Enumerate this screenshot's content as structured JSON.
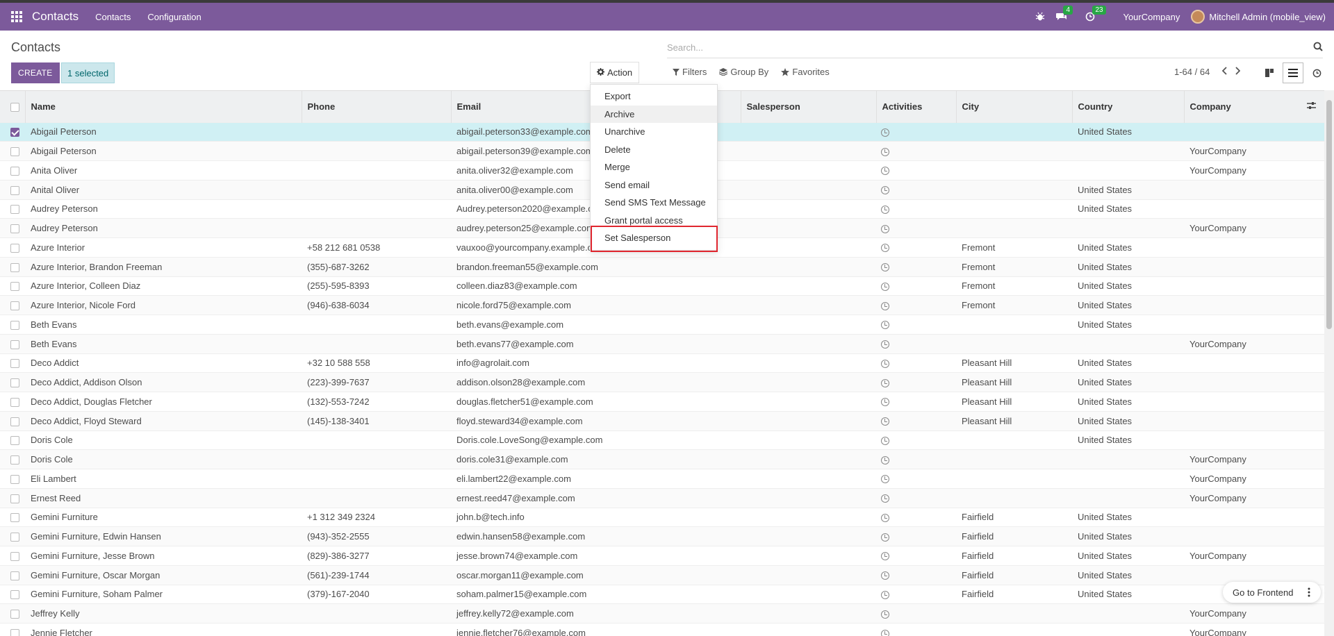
{
  "topbar": {
    "app_title": "Contacts",
    "menu": [
      "Contacts",
      "Configuration"
    ],
    "bug_icon": "bug-icon",
    "messages_count": "4",
    "activities_count": "23",
    "company": "YourCompany",
    "user": "Mitchell Admin (mobile_view)"
  },
  "control": {
    "breadcrumb": "Contacts",
    "search_placeholder": "Search...",
    "create_label": "CREATE",
    "selected_label": "1 selected",
    "action_label": "Action",
    "filters_label": "Filters",
    "groupby_label": "Group By",
    "favorites_label": "Favorites",
    "pager": "1-64 / 64"
  },
  "action_menu": {
    "items": [
      "Export",
      "Archive",
      "Unarchive",
      "Delete",
      "Merge",
      "Send email",
      "Send SMS Text Message",
      "Grant portal access",
      "Set Salesperson"
    ],
    "hover_item": "Archive",
    "highlighted_item": "Set Salesperson"
  },
  "table": {
    "columns": [
      "Name",
      "Phone",
      "Email",
      "Salesperson",
      "Activities",
      "City",
      "Country",
      "Company"
    ],
    "rows": [
      {
        "name": "Abigail Peterson",
        "phone": "",
        "email": "abigail.peterson33@example.com",
        "city": "",
        "country": "United States",
        "company": "",
        "selected": true
      },
      {
        "name": "Abigail Peterson",
        "phone": "",
        "email": "abigail.peterson39@example.com",
        "city": "",
        "country": "",
        "company": "YourCompany"
      },
      {
        "name": "Anita Oliver",
        "phone": "",
        "email": "anita.oliver32@example.com",
        "city": "",
        "country": "",
        "company": "YourCompany"
      },
      {
        "name": "Anital Oliver",
        "phone": "",
        "email": "anita.oliver00@example.com",
        "city": "",
        "country": "United States",
        "company": ""
      },
      {
        "name": "Audrey Peterson",
        "phone": "",
        "email": "Audrey.peterson2020@example.com",
        "city": "",
        "country": "United States",
        "company": ""
      },
      {
        "name": "Audrey Peterson",
        "phone": "",
        "email": "audrey.peterson25@example.com",
        "city": "",
        "country": "",
        "company": "YourCompany"
      },
      {
        "name": "Azure Interior",
        "phone": "+58 212 681 0538",
        "email": "vauxoo@yourcompany.example.com",
        "city": "Fremont",
        "country": "United States",
        "company": ""
      },
      {
        "name": "Azure Interior, Brandon Freeman",
        "phone": "(355)-687-3262",
        "email": "brandon.freeman55@example.com",
        "city": "Fremont",
        "country": "United States",
        "company": ""
      },
      {
        "name": "Azure Interior, Colleen Diaz",
        "phone": "(255)-595-8393",
        "email": "colleen.diaz83@example.com",
        "city": "Fremont",
        "country": "United States",
        "company": ""
      },
      {
        "name": "Azure Interior, Nicole Ford",
        "phone": "(946)-638-6034",
        "email": "nicole.ford75@example.com",
        "city": "Fremont",
        "country": "United States",
        "company": ""
      },
      {
        "name": "Beth Evans",
        "phone": "",
        "email": "beth.evans@example.com",
        "city": "",
        "country": "United States",
        "company": ""
      },
      {
        "name": "Beth Evans",
        "phone": "",
        "email": "beth.evans77@example.com",
        "city": "",
        "country": "",
        "company": "YourCompany"
      },
      {
        "name": "Deco Addict",
        "phone": "+32 10 588 558",
        "email": "info@agrolait.com",
        "city": "Pleasant Hill",
        "country": "United States",
        "company": ""
      },
      {
        "name": "Deco Addict, Addison Olson",
        "phone": "(223)-399-7637",
        "email": "addison.olson28@example.com",
        "city": "Pleasant Hill",
        "country": "United States",
        "company": ""
      },
      {
        "name": "Deco Addict, Douglas Fletcher",
        "phone": "(132)-553-7242",
        "email": "douglas.fletcher51@example.com",
        "city": "Pleasant Hill",
        "country": "United States",
        "company": ""
      },
      {
        "name": "Deco Addict, Floyd Steward",
        "phone": "(145)-138-3401",
        "email": "floyd.steward34@example.com",
        "city": "Pleasant Hill",
        "country": "United States",
        "company": ""
      },
      {
        "name": "Doris Cole",
        "phone": "",
        "email": "Doris.cole.LoveSong@example.com",
        "city": "",
        "country": "United States",
        "company": ""
      },
      {
        "name": "Doris Cole",
        "phone": "",
        "email": "doris.cole31@example.com",
        "city": "",
        "country": "",
        "company": "YourCompany"
      },
      {
        "name": "Eli Lambert",
        "phone": "",
        "email": "eli.lambert22@example.com",
        "city": "",
        "country": "",
        "company": "YourCompany"
      },
      {
        "name": "Ernest Reed",
        "phone": "",
        "email": "ernest.reed47@example.com",
        "city": "",
        "country": "",
        "company": "YourCompany"
      },
      {
        "name": "Gemini Furniture",
        "phone": "+1 312 349 2324",
        "email": "john.b@tech.info",
        "city": "Fairfield",
        "country": "United States",
        "company": ""
      },
      {
        "name": "Gemini Furniture, Edwin Hansen",
        "phone": "(943)-352-2555",
        "email": "edwin.hansen58@example.com",
        "city": "Fairfield",
        "country": "United States",
        "company": ""
      },
      {
        "name": "Gemini Furniture, Jesse Brown",
        "phone": "(829)-386-3277",
        "email": "jesse.brown74@example.com",
        "city": "Fairfield",
        "country": "United States",
        "company": "YourCompany"
      },
      {
        "name": "Gemini Furniture, Oscar Morgan",
        "phone": "(561)-239-1744",
        "email": "oscar.morgan11@example.com",
        "city": "Fairfield",
        "country": "United States",
        "company": ""
      },
      {
        "name": "Gemini Furniture, Soham Palmer",
        "phone": "(379)-167-2040",
        "email": "soham.palmer15@example.com",
        "city": "Fairfield",
        "country": "United States",
        "company": ""
      },
      {
        "name": "Jeffrey Kelly",
        "phone": "",
        "email": "jeffrey.kelly72@example.com",
        "city": "",
        "country": "",
        "company": "YourCompany"
      },
      {
        "name": "Jennie Fletcher",
        "phone": "",
        "email": "jennie.fletcher76@example.com",
        "city": "",
        "country": "",
        "company": "YourCompany"
      }
    ]
  },
  "frontend_button": "Go to Frontend",
  "colors": {
    "brand": "#7c5a9b",
    "selected_row": "#d0f0f4",
    "highlight_box": "#e0262f"
  }
}
